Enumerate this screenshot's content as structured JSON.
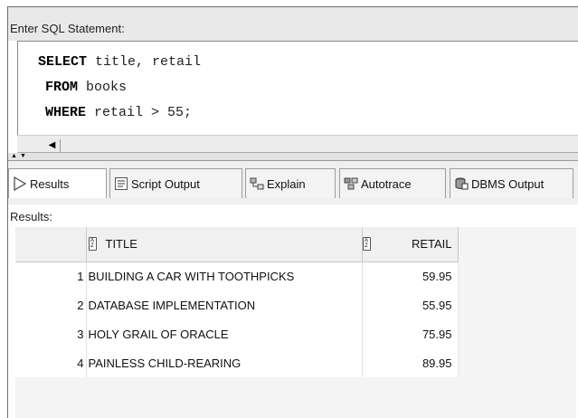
{
  "sql_panel": {
    "header": "Enter SQL Statement:",
    "lines": [
      {
        "keyword": "SELECT",
        "rest": " title, retail"
      },
      {
        "keyword": "FROM",
        "rest": " books"
      },
      {
        "keyword": "WHERE",
        "rest": " retail > 55;"
      }
    ]
  },
  "tabs": [
    {
      "label": "Results",
      "icon": "play-triangle-icon"
    },
    {
      "label": "Script Output",
      "icon": "script-output-icon"
    },
    {
      "label": "Explain",
      "icon": "explain-plan-icon"
    },
    {
      "label": "Autotrace",
      "icon": "autotrace-icon"
    },
    {
      "label": "DBMS Output",
      "icon": "dbms-output-icon"
    }
  ],
  "results": {
    "label": "Results:",
    "columns": [
      "TITLE",
      "RETAIL"
    ],
    "rows": [
      {
        "num": "1",
        "title": "BUILDING A CAR WITH TOOTHPICKS",
        "retail": "59.95"
      },
      {
        "num": "2",
        "title": "DATABASE IMPLEMENTATION",
        "retail": "55.95"
      },
      {
        "num": "3",
        "title": "HOLY GRAIL OF ORACLE",
        "retail": "75.95"
      },
      {
        "num": "4",
        "title": "PAINLESS CHILD-REARING",
        "retail": "89.95"
      }
    ]
  }
}
